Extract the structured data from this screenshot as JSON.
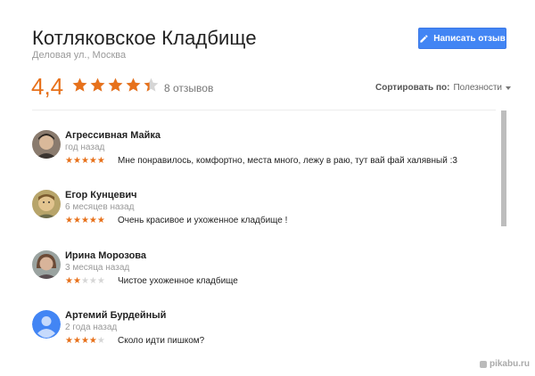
{
  "place": {
    "title": "Котляковское Кладбище",
    "address": "Деловая ул., Москва"
  },
  "write_review": {
    "label": "Написать отзыв",
    "icon": "pencil-icon"
  },
  "summary": {
    "rating": "4,4",
    "rating_value": 4.4,
    "review_count": "8 отзывов"
  },
  "sort": {
    "label": "Сортировать по:",
    "value": "Полезности"
  },
  "colors": {
    "accent_star": "#e7711b",
    "button_blue": "#4285f4",
    "star_empty": "#d6d6d6"
  },
  "reviews": [
    {
      "name": "Агрессивная Майка",
      "time": "год назад",
      "stars": 5,
      "text": "Мне понравилось, комфортно, места много, лежу в раю, тут вай фай халявный :3"
    },
    {
      "name": "Егор Кунцевич",
      "time": "6 месяцев назад",
      "stars": 5,
      "text": "Очень красивое и ухоженное кладбище !"
    },
    {
      "name": "Ирина Морозова",
      "time": "3 месяца назад",
      "stars": 2,
      "text": "Чистое ухоженное  кладбище"
    },
    {
      "name": "Артемий Бурдейный",
      "time": "2 года назад",
      "stars": 4,
      "text": "Сколо идти пишком?"
    }
  ],
  "watermark": "pikabu.ru"
}
